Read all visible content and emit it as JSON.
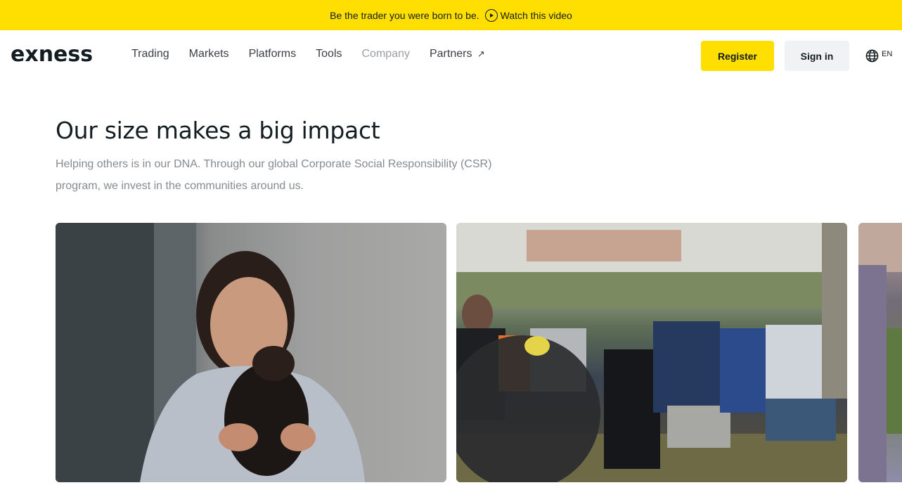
{
  "promo": {
    "text": "Be the trader you were born to be.",
    "link_label": "Watch this video",
    "link_icon": "play-circle-icon",
    "background": "#ffde02"
  },
  "header": {
    "logo": "exness",
    "nav": [
      {
        "label": "Trading",
        "active": false
      },
      {
        "label": "Markets",
        "active": false
      },
      {
        "label": "Platforms",
        "active": false
      },
      {
        "label": "Tools",
        "active": false
      },
      {
        "label": "Company",
        "active": true
      },
      {
        "label": "Partners",
        "active": false,
        "icon": "external-arrow-icon",
        "icon_glyph": "↗"
      }
    ],
    "register_label": "Register",
    "signin_label": "Sign in",
    "language": {
      "icon": "globe-icon",
      "code": "EN"
    }
  },
  "main": {
    "title": "Our size makes a big impact",
    "description": "Helping others is in our DNA. Through our global Corporate Social Responsibility (CSR) program, we invest in the communities around us.",
    "cards": [
      {
        "alt": "Woman smiling while holding a puppy"
      },
      {
        "alt": "People seated outdoors at a community event"
      },
      {
        "alt": "Partially visible photo"
      }
    ]
  }
}
